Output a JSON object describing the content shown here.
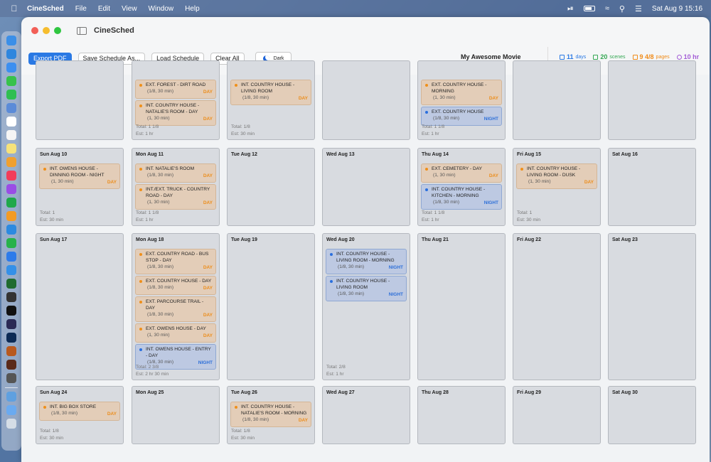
{
  "menubar": {
    "app_name": "CineSched",
    "menus": [
      "File",
      "Edit",
      "View",
      "Window",
      "Help"
    ],
    "clock": "Sat Aug 9  15:16"
  },
  "window": {
    "title": "CineSched"
  },
  "toolbar": {
    "export_pdf": "Export PDF",
    "save_as": "Save Schedule As...",
    "load": "Load Schedule",
    "clear_all": "Clear All",
    "dark_mode": "Dark"
  },
  "header": {
    "movie_title": "My Awesome Movie"
  },
  "stats": {
    "days": {
      "value": "11",
      "unit": "days",
      "color": "#2a79e4"
    },
    "scenes": {
      "value": "20",
      "unit": "scenes",
      "color": "#34a853"
    },
    "pages": {
      "value": "9 4/8",
      "unit": "pages",
      "color": "#f08c1a"
    },
    "hours": {
      "value": "10 hr",
      "unit": "",
      "color": "#a25bd6"
    }
  },
  "calendar": {
    "rows": [
      {
        "cells": [
          {
            "label": "",
            "scenes": [],
            "total": "",
            "est": ""
          },
          {
            "label": "",
            "scenes": [
              {
                "name": "EXT. FOREST - DIRT ROAD",
                "meta": "(1/8, 30 min)",
                "tag": "DAY"
              },
              {
                "name": "INT. COUNTRY HOUSE - NATALIE'S ROOM - DAY",
                "meta": "(1, 30 min)",
                "tag": "DAY"
              }
            ],
            "total": "Total: 1 1/8",
            "est": "Est: 1 hr"
          },
          {
            "label": "",
            "scenes": [
              {
                "name": "INT. COUNTRY HOUSE - LIVING ROOM",
                "meta": "(1/8, 30 min)",
                "tag": "DAY"
              }
            ],
            "total": "Total: 1/8",
            "est": "Est: 30 min"
          },
          {
            "label": "",
            "scenes": [],
            "total": "",
            "est": ""
          },
          {
            "label": "",
            "scenes": [
              {
                "name": "EXT. COUNTRY HOUSE - MORNING",
                "meta": "(1, 30 min)",
                "tag": "DAY"
              },
              {
                "name": "EXT. COUNTRY HOUSE",
                "meta": "(1/8, 30 min)",
                "tag": "NIGHT"
              }
            ],
            "total": "Total: 1 1/8",
            "est": "Est: 1 hr"
          },
          {
            "label": "",
            "scenes": [],
            "total": "",
            "est": ""
          },
          {
            "label": "",
            "scenes": [],
            "total": "",
            "est": ""
          }
        ]
      },
      {
        "cells": [
          {
            "label": "Sun Aug 10",
            "scenes": [
              {
                "name": "INT. OWENS HOUSE - DINNING ROOM - NIGHT",
                "meta": "(1, 30 min)",
                "tag": "DAY"
              }
            ],
            "total": "Total: 1",
            "est": "Est: 30 min"
          },
          {
            "label": "Mon Aug 11",
            "scenes": [
              {
                "name": "INT. NATALIE'S ROOM",
                "meta": "(1/8, 30 min)",
                "tag": "DAY"
              },
              {
                "name": "INT./EXT. TRUCK - COUNTRY ROAD - DAY",
                "meta": "(1, 30 min)",
                "tag": "DAY"
              }
            ],
            "total": "Total: 1 1/8",
            "est": "Est: 1 hr"
          },
          {
            "label": "Tue Aug 12",
            "scenes": [],
            "total": "",
            "est": ""
          },
          {
            "label": "Wed Aug 13",
            "scenes": [],
            "total": "",
            "est": ""
          },
          {
            "label": "Thu Aug 14",
            "scenes": [
              {
                "name": "EXT. CEMETERY - DAY",
                "meta": "(1, 30 min)",
                "tag": "DAY"
              },
              {
                "name": "INT. COUNTRY HOUSE - KITCHEN - MORNING",
                "meta": "(1/8, 30 min)",
                "tag": "NIGHT"
              }
            ],
            "total": "Total: 1 1/8",
            "est": "Est: 1 hr"
          },
          {
            "label": "Fri Aug 15",
            "scenes": [
              {
                "name": "INT. COUNTRY HOUSE - LIVING ROOM - DUSK",
                "meta": "(1, 30 min)",
                "tag": "DAY"
              }
            ],
            "total": "Total: 1",
            "est": "Est: 30 min"
          },
          {
            "label": "Sat Aug 16",
            "scenes": [],
            "total": "",
            "est": ""
          }
        ]
      },
      {
        "cells": [
          {
            "label": "Sun Aug 17",
            "scenes": [],
            "total": "",
            "est": ""
          },
          {
            "label": "Mon Aug 18",
            "scenes": [
              {
                "name": "EXT. COUNTRY ROAD - BUS STOP - DAY",
                "meta": "(1/8, 30 min)",
                "tag": "DAY"
              },
              {
                "name": "EXT. COUNTRY HOUSE - DAY",
                "meta": "(1/8, 30 min)",
                "tag": "DAY"
              },
              {
                "name": "EXT. PARCOURSE TRAIL - DAY",
                "meta": "(1/8, 30 min)",
                "tag": "DAY"
              },
              {
                "name": "EXT. OWENS HOUSE - DAY",
                "meta": "(1, 30 min)",
                "tag": "DAY"
              },
              {
                "name": "INT. OWENS HOUSE - ENTRY - DAY",
                "meta": "(1/8, 30 min)",
                "tag": "NIGHT"
              }
            ],
            "total": "Total: 2 3/8",
            "est": "Est: 2 hr 30 min"
          },
          {
            "label": "Tue Aug 19",
            "scenes": [],
            "total": "",
            "est": ""
          },
          {
            "label": "Wed Aug 20",
            "scenes": [
              {
                "name": "INT. COUNTRY HOUSE - LIVING ROOM - MORNING",
                "meta": "(1/8, 30 min)",
                "tag": "NIGHT"
              },
              {
                "name": "INT. COUNTRY HOUSE - LIVING ROOM",
                "meta": "(1/8, 30 min)",
                "tag": "NIGHT"
              }
            ],
            "total": "Total: 2/8",
            "est": "Est: 1 hr"
          },
          {
            "label": "Thu Aug 21",
            "scenes": [],
            "total": "",
            "est": ""
          },
          {
            "label": "Fri Aug 22",
            "scenes": [],
            "total": "",
            "est": ""
          },
          {
            "label": "Sat Aug 23",
            "scenes": [],
            "total": "",
            "est": ""
          }
        ]
      },
      {
        "cells": [
          {
            "label": "Sun Aug 24",
            "scenes": [
              {
                "name": "INT. BIG BOX STORE",
                "meta": "(1/8, 30 min)",
                "tag": "DAY"
              }
            ],
            "total": "Total: 1/8",
            "est": "Est: 30 min"
          },
          {
            "label": "Mon Aug 25",
            "scenes": [],
            "total": "",
            "est": ""
          },
          {
            "label": "Tue Aug 26",
            "scenes": [
              {
                "name": "INT. COUNTRY HOUSE - NATALIE'S ROOM - MORNING",
                "meta": "(1/8, 30 min)",
                "tag": "DAY"
              }
            ],
            "total": "Total: 1/8",
            "est": "Est: 30 min"
          },
          {
            "label": "Wed Aug 27",
            "scenes": [],
            "total": "",
            "est": ""
          },
          {
            "label": "Thu Aug 28",
            "scenes": [],
            "total": "",
            "est": ""
          },
          {
            "label": "Fri Aug 29",
            "scenes": [],
            "total": "",
            "est": ""
          },
          {
            "label": "Sat Aug 30",
            "scenes": [],
            "total": "",
            "est": ""
          }
        ]
      }
    ]
  }
}
